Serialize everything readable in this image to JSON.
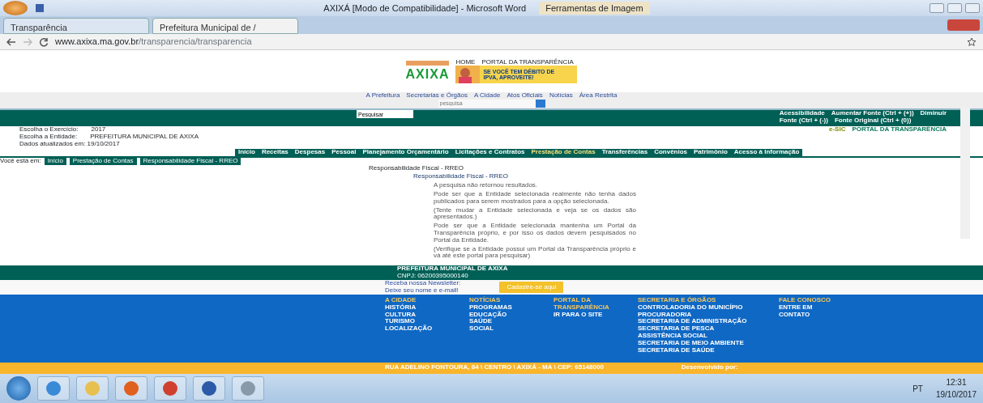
{
  "word_window": {
    "title": "AXIXÁ [Modo de Compatibilidade] - Microsoft Word",
    "context_tab": "Ferramentas de Imagem"
  },
  "browser": {
    "tabs": [
      {
        "label": "Transparência",
        "selected": false
      },
      {
        "label": "Prefeitura Municipal de /",
        "selected": true
      }
    ],
    "address": {
      "host": "www.axixa.ma.gov.br",
      "path": "/transparencia/transparencia"
    }
  },
  "site": {
    "logo": "AXIXA",
    "header_tabs": [
      "HOME",
      "PORTAL DA TRANSPARÊNCIA"
    ],
    "banner": "SE VOCÊ TEM DÉBITO DE IPVA, APROVEITE!",
    "top_nav": [
      "A Prefeitura",
      "Secretarias e Órgãos",
      "A Cidade",
      "Atos Oficiais",
      "Notícias",
      "Área Restrita"
    ],
    "search_placeholder": "pesquisa",
    "toolbar": {
      "search_value": "Pesquisar",
      "items": [
        "Acessibilidade",
        "Aumentar Fonte (Ctrl + (+))",
        "Diminuir"
      ],
      "items2": [
        "Fonte (Ctrl + (-))",
        "Fonte Original (Ctrl + (0))"
      ]
    },
    "filters": [
      {
        "label": "Escolha o Exercício:",
        "value": "2017"
      },
      {
        "label": "Escolha a Entidade:",
        "value": "PREFEITURA MUNICIPAL DE AXIXA"
      }
    ],
    "updated": "Dados atualizados em: 19/10/2017",
    "menu": [
      {
        "label": "Início",
        "selected": false
      },
      {
        "label": "Receitas",
        "selected": false
      },
      {
        "label": "Despesas",
        "selected": false
      },
      {
        "label": "Pessoal",
        "selected": false
      },
      {
        "label": "Planejamento Orçamentário",
        "selected": false
      },
      {
        "label": "Licitações e Contratos",
        "selected": false
      },
      {
        "label": "Prestação de Contas",
        "selected": true
      },
      {
        "label": "Transferências",
        "selected": false
      },
      {
        "label": "Convênios",
        "selected": false
      },
      {
        "label": "Patrimônio",
        "selected": false
      },
      {
        "label": "Acesso à Informação",
        "selected": false
      }
    ],
    "badges": [
      "e-SIC",
      "PORTAL DA TRANSPARÊNCIA"
    ],
    "breadcrumb": {
      "prefix": "Você está em:",
      "items": [
        "Início",
        "Prestação de Contas",
        "Responsabilidade Fiscal - RREO"
      ]
    },
    "page_title": "Responsabilidade Fiscal - RREO",
    "result_title": "Responsabilidade Fiscal - RREO",
    "messages": [
      "A pesquisa não retornou resultados.",
      "Pode ser que a Entidade selecionada realmente não tenha dados publicados para serem mostrados para a opção selecionada.",
      "(Tente mudar a Entidade selecionada e veja se os dados são apresentados.)",
      "Pode ser que a Entidade selecionada mantenha um Portal da Transparência próprio, e por isso os dados devem pesquisados no Portal da Entidade.",
      "(Verifique se a Entidade possui um Portal da Transparência próprio e vá até este portal para pesquisar)"
    ],
    "footer": {
      "name": "PREFEITURA MUNICIPAL DE AXIXA",
      "cnpj": "CNPJ: 06200395000140",
      "newsletter": [
        "Receba nossa Newsletter:",
        "Deixe seu nome e e-mail!"
      ],
      "newsletter_button": "Cadastre-se aqui",
      "columns": [
        {
          "title": "A CIDADE",
          "links": [
            "HISTÓRIA",
            "CULTURA",
            "TURISMO",
            "LOCALIZAÇÃO"
          ]
        },
        {
          "title": "NOTÍCIAS",
          "links": [
            "PROGRAMAS",
            "EDUCAÇÃO",
            "SAÚDE",
            "SOCIAL"
          ]
        },
        {
          "title": "PORTAL DA TRANSPARÊNCIA",
          "links": [
            "IR PARA O SITE"
          ]
        },
        {
          "title": "SECRETARIA E ÓRGÃOS",
          "links": [
            "CONTROLADORIA DO MUNICÍPIO",
            "PROCURADORIA",
            "SECRETARIA DE ADMINISTRAÇÃO",
            "SECRETARIA DE PESCA",
            "ASSISTÊNCIA SOCIAL",
            "SECRETARIA DE MEIO AMBIENTE",
            "SECRETARIA DE SAÚDE"
          ]
        },
        {
          "title": "FALE CONOSCO",
          "links": [
            "ENTRE EM CONTATO"
          ]
        }
      ],
      "address": "RUA ADELINO FONTOURA, 84 \\ CENTRO \\ AXIXÁ - MA \\ CEP: 65148000",
      "credit": "Desenvolvido por:"
    }
  },
  "taskbar": {
    "language": "PT",
    "time": "12:31",
    "date": "19/10/2017"
  }
}
